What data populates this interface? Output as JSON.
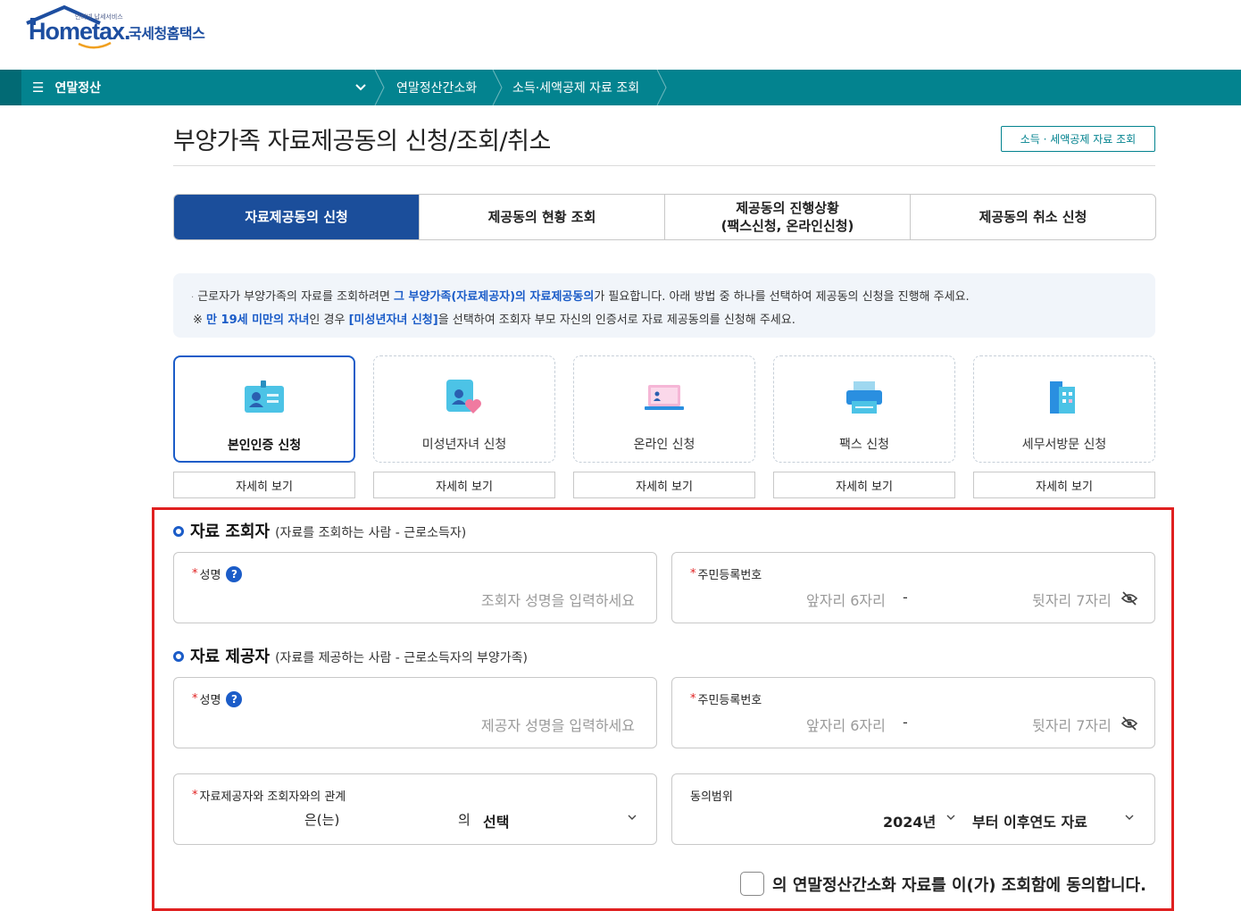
{
  "header": {
    "logo_small": "인터넷 납세서비스",
    "logo_main": "Hometax.",
    "logo_kr": "국세청홈택스"
  },
  "nav": {
    "menu_label": "연말정산",
    "breadcrumb": [
      "연말정산간소화",
      "소득·세액공제 자료 조회"
    ]
  },
  "page": {
    "title": "부양가족 자료제공동의 신청/조회/취소",
    "top_button": "소득 · 세액공제 자료 조회"
  },
  "tabs": [
    {
      "label": "자료제공동의 신청",
      "active": true
    },
    {
      "label": "제공동의 현황 조회",
      "active": false
    },
    {
      "label": "제공동의 진행상황\n(팩스신청, 온라인신청)",
      "active": false
    },
    {
      "label": "제공동의 취소 신청",
      "active": false
    }
  ],
  "info": {
    "line1_a": "근로자가 부양가족의 자료를 조회하려면 ",
    "line1_hl": "그 부양가족(자료제공자)의 자료제공동의",
    "line1_b": "가 필요합니다. 아래 방법 중 하나를 선택하여 제공동의 신청을 진행해 주세요.",
    "line2_prefix": "※ ",
    "line2_hl1": "만 19세 미만의 자녀",
    "line2_a": "인 경우 ",
    "line2_hl2": "[미성년자녀 신청]",
    "line2_b": "을 선택하여 조회자 부모 자신의 인증서로 자료 제공동의를 신청해 주세요."
  },
  "methods": [
    {
      "label": "본인인증 신청",
      "icon": "id-card-icon",
      "detail": "자세히 보기",
      "selected": true
    },
    {
      "label": "미성년자녀 신청",
      "icon": "child-heart-icon",
      "detail": "자세히 보기",
      "selected": false
    },
    {
      "label": "온라인 신청",
      "icon": "laptop-icon",
      "detail": "자세히 보기",
      "selected": false
    },
    {
      "label": "팩스 신청",
      "icon": "fax-icon",
      "detail": "자세히 보기",
      "selected": false
    },
    {
      "label": "세무서방문 신청",
      "icon": "building-icon",
      "detail": "자세히 보기",
      "selected": false
    }
  ],
  "inquirer": {
    "title": "자료 조회자",
    "subtitle": "(자료를 조회하는 사람 - 근로소득자)",
    "name_label": "성명",
    "name_placeholder": "조회자 성명을 입력하세요",
    "rrn_label": "주민등록번호",
    "rrn_front_placeholder": "앞자리 6자리",
    "rrn_dash": "-",
    "rrn_back_placeholder": "뒷자리 7자리"
  },
  "provider": {
    "title": "자료 제공자",
    "subtitle": "(자료를 제공하는 사람 - 근로소득자의 부양가족)",
    "name_label": "성명",
    "name_placeholder": "제공자 성명을 입력하세요",
    "rrn_label": "주민등록번호",
    "rrn_front_placeholder": "앞자리 6자리",
    "rrn_dash": "-",
    "rrn_back_placeholder": "뒷자리 7자리"
  },
  "relation": {
    "label": "자료제공자와 조회자와의 관계",
    "eun": "은(는)",
    "ui": "의",
    "select_value": "선택"
  },
  "scope": {
    "label": "동의범위",
    "year_value": "2024년",
    "range_value": "부터 이후연도 자료"
  },
  "agreement": {
    "text": "의 연말정산간소화 자료를 이(가) 조회함에 동의합니다."
  },
  "colors": {
    "nav": "#03838f",
    "primary": "#1b4e9b",
    "accent": "#1b5cc8",
    "highlight_border": "#e02020"
  }
}
